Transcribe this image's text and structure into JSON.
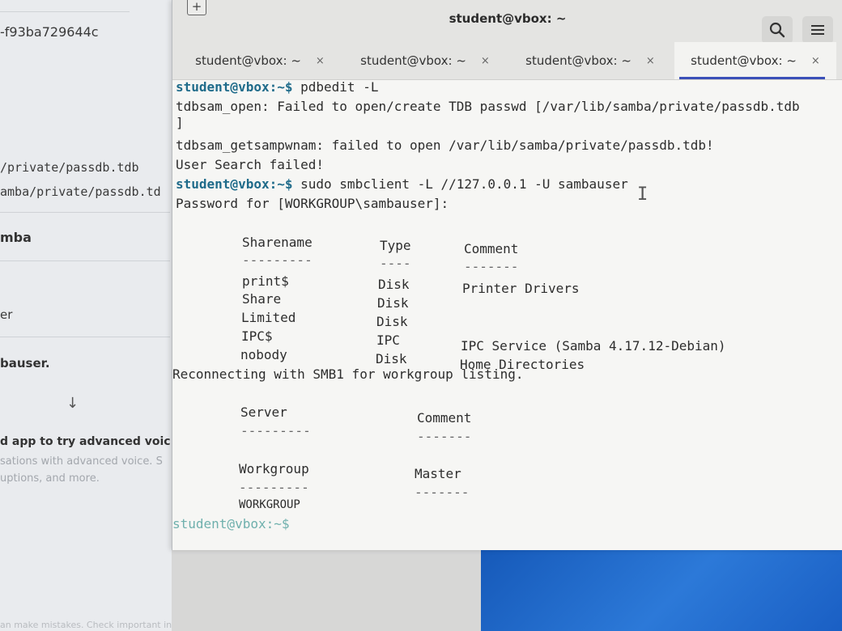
{
  "background_app": {
    "hash_text": "-f93ba729644c",
    "path1": "/private/passdb.tdb",
    "path2": "amba/private/passdb.td",
    "heading": "mba",
    "item1": "er",
    "item2": "bauser.",
    "arrow": "↓",
    "promo_title": "d app to try advanced voice m",
    "promo_line1": "sations with advanced voice. S",
    "promo_line2": "uptions, and more.",
    "footer": "an make mistakes. Check important info."
  },
  "terminal": {
    "window_title": "student@vbox: ~",
    "new_tab_icon": "+",
    "tabs": [
      {
        "label": "student@vbox: ~",
        "close": "×"
      },
      {
        "label": "student@vbox: ~",
        "close": "×"
      },
      {
        "label": "student@vbox: ~",
        "close": "×"
      },
      {
        "label": "student@vbox: ~",
        "close": "×"
      }
    ],
    "lines": {
      "l1_prompt": "student@vbox:~$",
      "l1_cmd": " pdbedit -L",
      "l2": "tdbsam_open: Failed to open/create TDB passwd [/var/lib/samba/private/passdb.tdb",
      "l3": "]",
      "l4": "tdbsam_getsampwnam: failed to open /var/lib/samba/private/passdb.tdb!",
      "l5": "User Search failed!",
      "l6_prompt": "student@vbox:~$",
      "l6_cmd": " sudo smbclient -L //127.0.0.1 -U sambauser",
      "l7": "Password for [WORKGROUP\\sambauser]:",
      "reconnect": "Reconnecting with SMB1 for workgroup listing.",
      "final_prompt": "student@vbox:~$"
    },
    "shares_header": {
      "name": "Sharename",
      "type": "Type",
      "comment": "Comment"
    },
    "shares_dashes": {
      "name": "---------",
      "type": "----",
      "comment": "-------"
    },
    "shares": [
      {
        "name": "print$",
        "type": "Disk",
        "comment": "Printer Drivers"
      },
      {
        "name": "Share",
        "type": "Disk",
        "comment": ""
      },
      {
        "name": "Limited",
        "type": "Disk",
        "comment": ""
      },
      {
        "name": "IPC$",
        "type": "IPC",
        "comment": "IPC Service (Samba 4.17.12-Debian)"
      },
      {
        "name": "nobody",
        "type": "Disk",
        "comment": "Home Directories"
      }
    ],
    "server_header": {
      "server": "Server",
      "comment": "Comment"
    },
    "server_dashes": {
      "server": "---------",
      "comment": "-------"
    },
    "workgroup_header": {
      "workgroup": "Workgroup",
      "master": "Master"
    },
    "workgroup_dashes": {
      "workgroup": "---------",
      "master": "-------"
    },
    "workgroups": [
      {
        "workgroup": "WORKGROUP",
        "master": ""
      }
    ]
  },
  "colors": {
    "prompt": "#1f6b8a",
    "tab_active_underline": "#3a4fb8",
    "wallpaper": "#1f66c8"
  },
  "icons": {
    "search": "search-icon",
    "menu": "hamburger-menu-icon",
    "new_tab": "new-tab-icon",
    "close": "close-icon",
    "text_cursor": "text-cursor-icon"
  }
}
